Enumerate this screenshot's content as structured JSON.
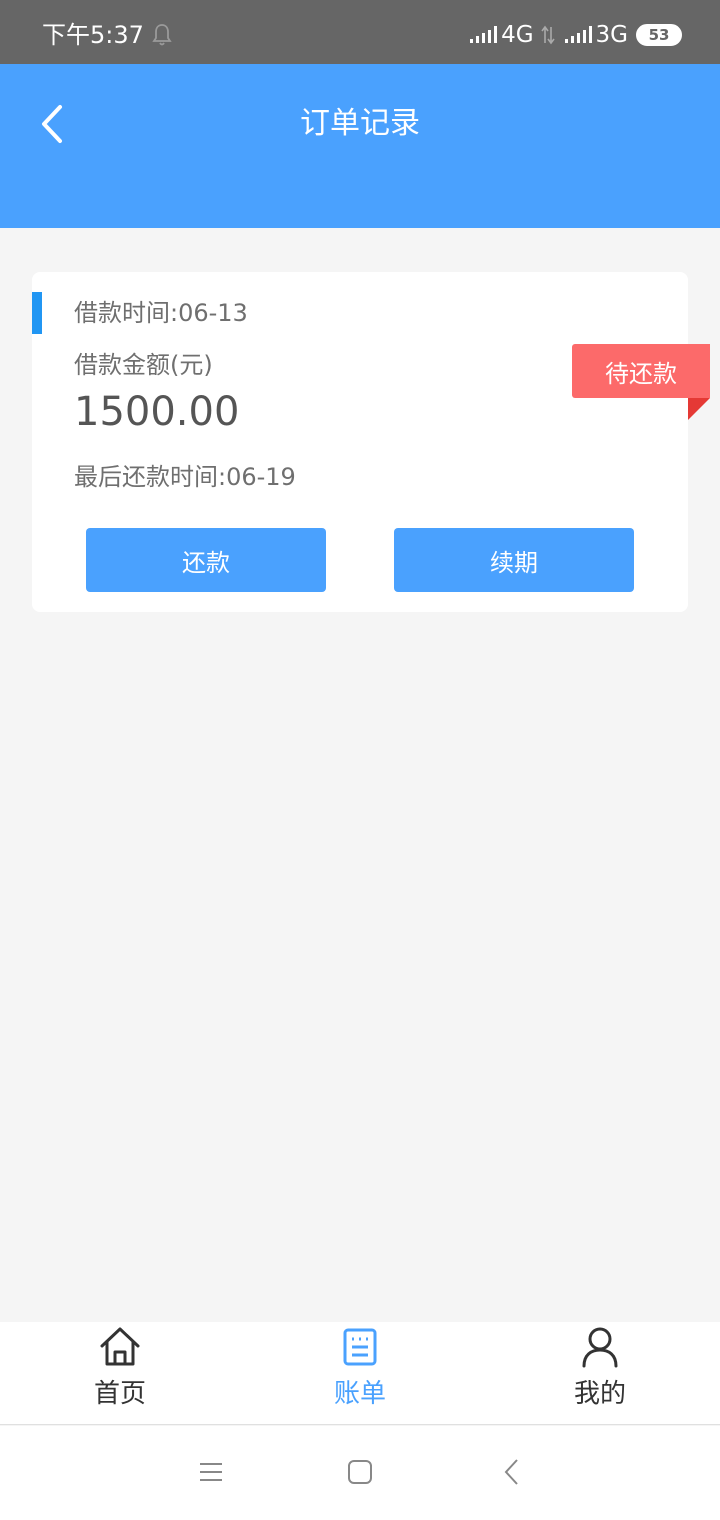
{
  "status_bar": {
    "time": "下午5:37",
    "network1": "4G",
    "network2": "3G",
    "battery": "53"
  },
  "header": {
    "title": "订单记录",
    "background": "#4aa1fe"
  },
  "order": {
    "loan_date": "借款时间:06-13",
    "amount_label": "借款金额(元)",
    "amount": "1500.00",
    "due_date": "最后还款时间:06-19",
    "status": "待还款",
    "status_color": "#fc6a6a",
    "repay_label": "还款",
    "renew_label": "续期"
  },
  "tabs": [
    {
      "label": "首页",
      "icon": "home-icon",
      "active": false
    },
    {
      "label": "账单",
      "icon": "bill-icon",
      "active": true
    },
    {
      "label": "我的",
      "icon": "user-icon",
      "active": false
    }
  ],
  "nav": {
    "icons": [
      "menu-icon",
      "home-square-icon",
      "back-triangle-icon"
    ]
  }
}
